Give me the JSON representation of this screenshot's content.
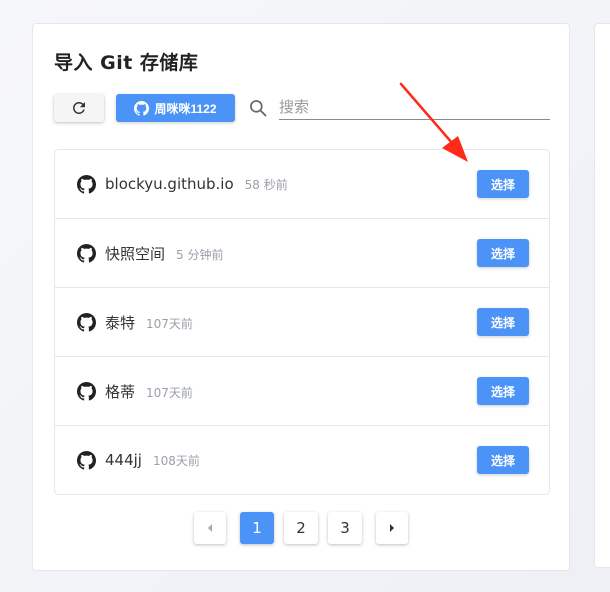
{
  "panel": {
    "title": "导入 Git 存储库"
  },
  "toolbar": {
    "refresh_icon": "refresh-icon",
    "user_label": "周咪咪1122",
    "search_placeholder": "搜索",
    "search_value": ""
  },
  "repos": [
    {
      "name": "blockyu.github.io",
      "time": "58 秒前",
      "action": "选择"
    },
    {
      "name": "快照空间",
      "time": "5 分钟前",
      "action": "选择"
    },
    {
      "name": "泰特",
      "time": "107天前",
      "action": "选择"
    },
    {
      "name": "格蒂",
      "time": "107天前",
      "action": "选择"
    },
    {
      "name": "444jj",
      "time": "108天前",
      "action": "选择"
    }
  ],
  "pagination": {
    "prev": "‹",
    "pages": [
      "1",
      "2",
      "3"
    ],
    "current": "1",
    "next": "›"
  },
  "colors": {
    "accent": "#4b93f7",
    "annotation": "#ff2a1a"
  }
}
